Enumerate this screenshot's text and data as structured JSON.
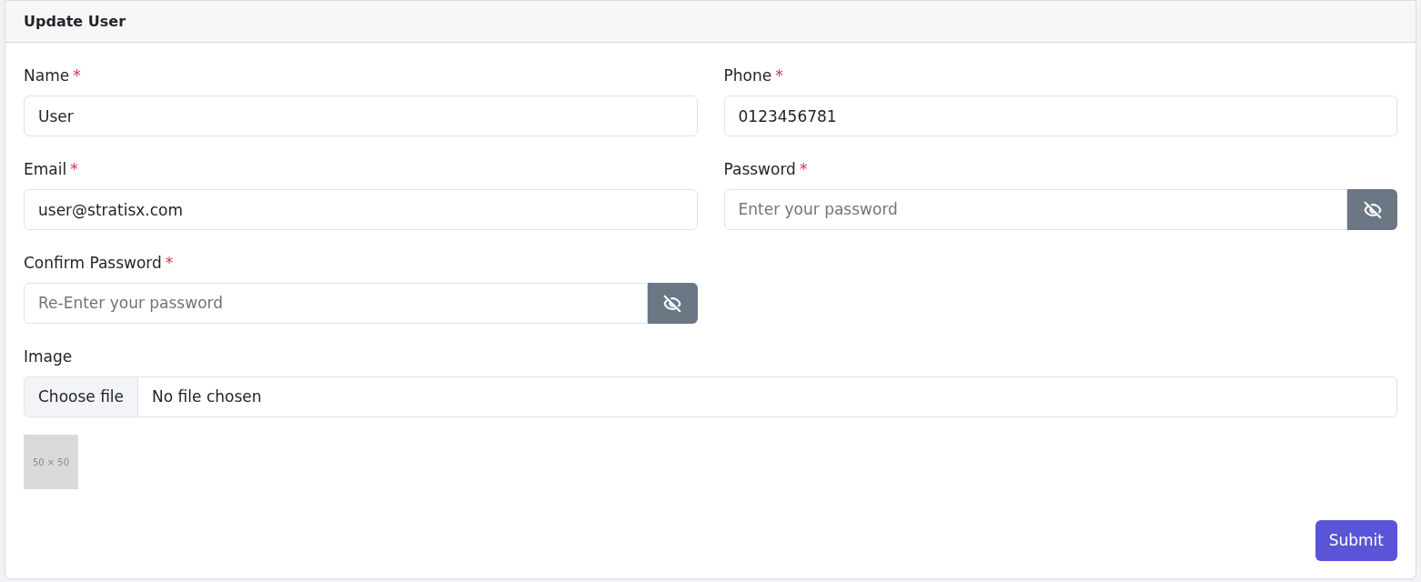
{
  "card": {
    "title": "Update User"
  },
  "fields": [
    {
      "kind": "text",
      "label": "Name",
      "required_mark": "*",
      "value": "User"
    },
    {
      "kind": "text",
      "label": "Phone",
      "required_mark": "*",
      "value": "0123456781"
    },
    {
      "kind": "text",
      "label": "Email",
      "required_mark": "*",
      "value": "user@stratisx.com"
    },
    {
      "kind": "password",
      "label": "Password",
      "required_mark": "*",
      "placeholder": "Enter your password",
      "visible": false
    },
    {
      "kind": "password",
      "label": "Confirm Password",
      "required_mark": "*",
      "placeholder": "Re-Enter your password",
      "visible": false
    },
    {
      "kind": "file",
      "label": "Image",
      "button": "Choose file",
      "status": "No file chosen"
    }
  ],
  "preview": {
    "text": "50 × 50"
  },
  "submit": "Submit"
}
